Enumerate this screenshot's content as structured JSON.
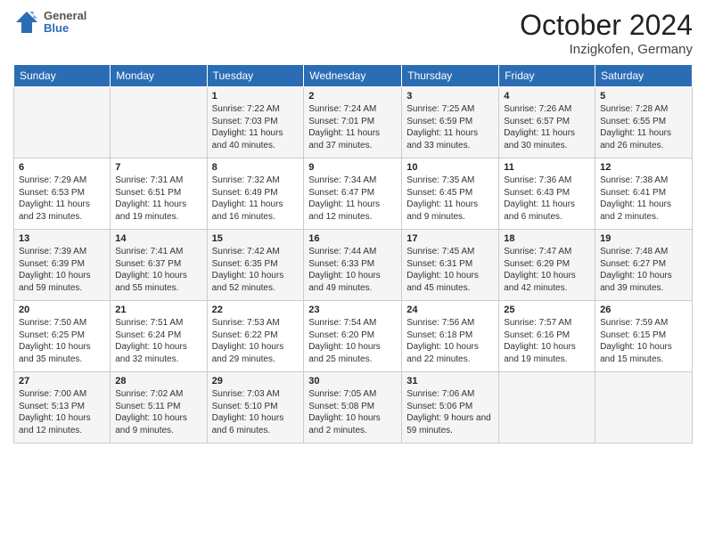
{
  "logo": {
    "general": "General",
    "blue": "Blue"
  },
  "title": {
    "month": "October 2024",
    "location": "Inzigkofen, Germany"
  },
  "days": [
    "Sunday",
    "Monday",
    "Tuesday",
    "Wednesday",
    "Thursday",
    "Friday",
    "Saturday"
  ],
  "weeks": [
    [
      {
        "num": "",
        "sunrise": "",
        "sunset": "",
        "daylight": ""
      },
      {
        "num": "",
        "sunrise": "",
        "sunset": "",
        "daylight": ""
      },
      {
        "num": "1",
        "sunrise": "Sunrise: 7:22 AM",
        "sunset": "Sunset: 7:03 PM",
        "daylight": "Daylight: 11 hours and 40 minutes."
      },
      {
        "num": "2",
        "sunrise": "Sunrise: 7:24 AM",
        "sunset": "Sunset: 7:01 PM",
        "daylight": "Daylight: 11 hours and 37 minutes."
      },
      {
        "num": "3",
        "sunrise": "Sunrise: 7:25 AM",
        "sunset": "Sunset: 6:59 PM",
        "daylight": "Daylight: 11 hours and 33 minutes."
      },
      {
        "num": "4",
        "sunrise": "Sunrise: 7:26 AM",
        "sunset": "Sunset: 6:57 PM",
        "daylight": "Daylight: 11 hours and 30 minutes."
      },
      {
        "num": "5",
        "sunrise": "Sunrise: 7:28 AM",
        "sunset": "Sunset: 6:55 PM",
        "daylight": "Daylight: 11 hours and 26 minutes."
      }
    ],
    [
      {
        "num": "6",
        "sunrise": "Sunrise: 7:29 AM",
        "sunset": "Sunset: 6:53 PM",
        "daylight": "Daylight: 11 hours and 23 minutes."
      },
      {
        "num": "7",
        "sunrise": "Sunrise: 7:31 AM",
        "sunset": "Sunset: 6:51 PM",
        "daylight": "Daylight: 11 hours and 19 minutes."
      },
      {
        "num": "8",
        "sunrise": "Sunrise: 7:32 AM",
        "sunset": "Sunset: 6:49 PM",
        "daylight": "Daylight: 11 hours and 16 minutes."
      },
      {
        "num": "9",
        "sunrise": "Sunrise: 7:34 AM",
        "sunset": "Sunset: 6:47 PM",
        "daylight": "Daylight: 11 hours and 12 minutes."
      },
      {
        "num": "10",
        "sunrise": "Sunrise: 7:35 AM",
        "sunset": "Sunset: 6:45 PM",
        "daylight": "Daylight: 11 hours and 9 minutes."
      },
      {
        "num": "11",
        "sunrise": "Sunrise: 7:36 AM",
        "sunset": "Sunset: 6:43 PM",
        "daylight": "Daylight: 11 hours and 6 minutes."
      },
      {
        "num": "12",
        "sunrise": "Sunrise: 7:38 AM",
        "sunset": "Sunset: 6:41 PM",
        "daylight": "Daylight: 11 hours and 2 minutes."
      }
    ],
    [
      {
        "num": "13",
        "sunrise": "Sunrise: 7:39 AM",
        "sunset": "Sunset: 6:39 PM",
        "daylight": "Daylight: 10 hours and 59 minutes."
      },
      {
        "num": "14",
        "sunrise": "Sunrise: 7:41 AM",
        "sunset": "Sunset: 6:37 PM",
        "daylight": "Daylight: 10 hours and 55 minutes."
      },
      {
        "num": "15",
        "sunrise": "Sunrise: 7:42 AM",
        "sunset": "Sunset: 6:35 PM",
        "daylight": "Daylight: 10 hours and 52 minutes."
      },
      {
        "num": "16",
        "sunrise": "Sunrise: 7:44 AM",
        "sunset": "Sunset: 6:33 PM",
        "daylight": "Daylight: 10 hours and 49 minutes."
      },
      {
        "num": "17",
        "sunrise": "Sunrise: 7:45 AM",
        "sunset": "Sunset: 6:31 PM",
        "daylight": "Daylight: 10 hours and 45 minutes."
      },
      {
        "num": "18",
        "sunrise": "Sunrise: 7:47 AM",
        "sunset": "Sunset: 6:29 PM",
        "daylight": "Daylight: 10 hours and 42 minutes."
      },
      {
        "num": "19",
        "sunrise": "Sunrise: 7:48 AM",
        "sunset": "Sunset: 6:27 PM",
        "daylight": "Daylight: 10 hours and 39 minutes."
      }
    ],
    [
      {
        "num": "20",
        "sunrise": "Sunrise: 7:50 AM",
        "sunset": "Sunset: 6:25 PM",
        "daylight": "Daylight: 10 hours and 35 minutes."
      },
      {
        "num": "21",
        "sunrise": "Sunrise: 7:51 AM",
        "sunset": "Sunset: 6:24 PM",
        "daylight": "Daylight: 10 hours and 32 minutes."
      },
      {
        "num": "22",
        "sunrise": "Sunrise: 7:53 AM",
        "sunset": "Sunset: 6:22 PM",
        "daylight": "Daylight: 10 hours and 29 minutes."
      },
      {
        "num": "23",
        "sunrise": "Sunrise: 7:54 AM",
        "sunset": "Sunset: 6:20 PM",
        "daylight": "Daylight: 10 hours and 25 minutes."
      },
      {
        "num": "24",
        "sunrise": "Sunrise: 7:56 AM",
        "sunset": "Sunset: 6:18 PM",
        "daylight": "Daylight: 10 hours and 22 minutes."
      },
      {
        "num": "25",
        "sunrise": "Sunrise: 7:57 AM",
        "sunset": "Sunset: 6:16 PM",
        "daylight": "Daylight: 10 hours and 19 minutes."
      },
      {
        "num": "26",
        "sunrise": "Sunrise: 7:59 AM",
        "sunset": "Sunset: 6:15 PM",
        "daylight": "Daylight: 10 hours and 15 minutes."
      }
    ],
    [
      {
        "num": "27",
        "sunrise": "Sunrise: 7:00 AM",
        "sunset": "Sunset: 5:13 PM",
        "daylight": "Daylight: 10 hours and 12 minutes."
      },
      {
        "num": "28",
        "sunrise": "Sunrise: 7:02 AM",
        "sunset": "Sunset: 5:11 PM",
        "daylight": "Daylight: 10 hours and 9 minutes."
      },
      {
        "num": "29",
        "sunrise": "Sunrise: 7:03 AM",
        "sunset": "Sunset: 5:10 PM",
        "daylight": "Daylight: 10 hours and 6 minutes."
      },
      {
        "num": "30",
        "sunrise": "Sunrise: 7:05 AM",
        "sunset": "Sunset: 5:08 PM",
        "daylight": "Daylight: 10 hours and 2 minutes."
      },
      {
        "num": "31",
        "sunrise": "Sunrise: 7:06 AM",
        "sunset": "Sunset: 5:06 PM",
        "daylight": "Daylight: 9 hours and 59 minutes."
      },
      {
        "num": "",
        "sunrise": "",
        "sunset": "",
        "daylight": ""
      },
      {
        "num": "",
        "sunrise": "",
        "sunset": "",
        "daylight": ""
      }
    ]
  ]
}
